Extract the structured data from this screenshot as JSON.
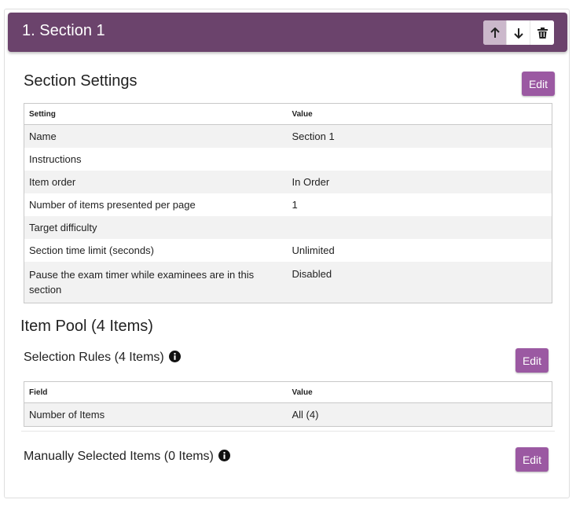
{
  "section": {
    "title": "1. Section 1",
    "actions": [
      {
        "icon": "arrow-up-icon",
        "active": true
      },
      {
        "icon": "arrow-down-icon",
        "active": false
      },
      {
        "icon": "trash-icon",
        "active": false
      }
    ]
  },
  "settings": {
    "heading": "Section Settings",
    "edit_label": "Edit",
    "columns": [
      "Setting",
      "Value"
    ],
    "rows": [
      {
        "setting": "Name",
        "value": "Section 1"
      },
      {
        "setting": "Instructions",
        "value": ""
      },
      {
        "setting": "Item order",
        "value": "In Order"
      },
      {
        "setting": "Number of items presented per page",
        "value": "1"
      },
      {
        "setting": "Target difficulty",
        "value": ""
      },
      {
        "setting": "Section time limit (seconds)",
        "value": "Unlimited"
      },
      {
        "setting": "Pause the exam timer while examinees are in this section",
        "value": "Disabled"
      }
    ]
  },
  "item_pool": {
    "heading": "Item Pool (4 Items)",
    "selection_rules": {
      "heading": "Selection Rules (4 Items)",
      "edit_label": "Edit",
      "columns": [
        "Field",
        "Value"
      ],
      "rows": [
        {
          "field": "Number of Items",
          "value": "All (4)"
        }
      ]
    },
    "manual": {
      "heading": "Manually Selected Items (0 Items)",
      "edit_label": "Edit"
    }
  },
  "colors": {
    "header_bg": "#6b436c",
    "button_bg": "#9b59a2",
    "active_button_bg": "#cbb8cb"
  }
}
